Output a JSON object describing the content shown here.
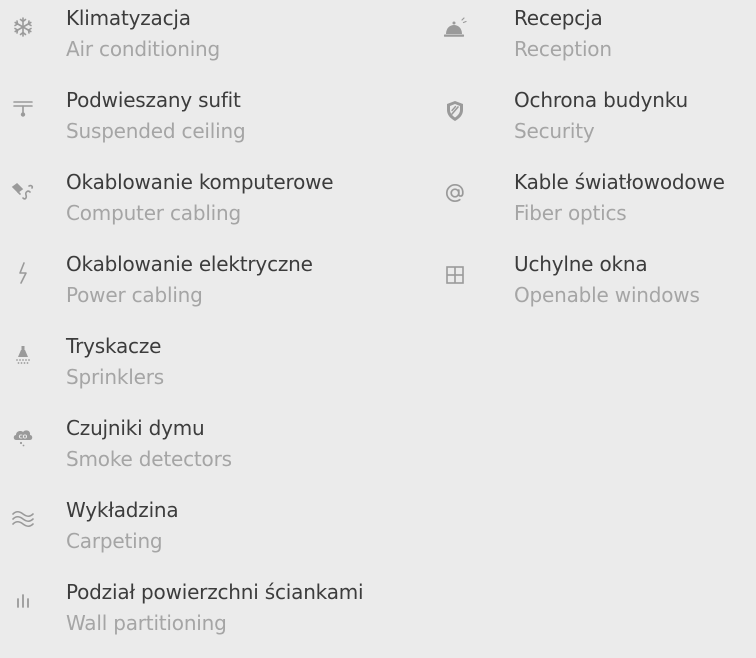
{
  "amenities": {
    "left": [
      {
        "icon": "snowflake-icon",
        "name": "Klimatyzacja",
        "sub": "Air conditioning"
      },
      {
        "icon": "ceiling-lamp-icon",
        "name": "Podwieszany sufit",
        "sub": "Suspended ceiling"
      },
      {
        "icon": "network-cable-icon",
        "name": "Okablowanie komputerowe",
        "sub": "Computer cabling"
      },
      {
        "icon": "lightning-icon",
        "name": "Okablowanie elektryczne",
        "sub": "Power cabling"
      },
      {
        "icon": "sprinkler-icon",
        "name": "Tryskacze",
        "sub": "Sprinklers"
      },
      {
        "icon": "smoke-cloud-icon",
        "name": "Czujniki dymu",
        "sub": "Smoke detectors"
      },
      {
        "icon": "wavy-lines-icon",
        "name": "Wykładzina",
        "sub": "Carpeting"
      },
      {
        "icon": "partition-bars-icon",
        "name": "Podział powierzchni ściankami",
        "sub": "Wall partitioning"
      }
    ],
    "right": [
      {
        "icon": "service-bell-icon",
        "name": "Recepcja",
        "sub": "Reception"
      },
      {
        "icon": "shield-icon",
        "name": "Ochrona budynku",
        "sub": "Security"
      },
      {
        "icon": "at-sign-icon",
        "name": "Kable światłowodowe",
        "sub": "Fiber optics"
      },
      {
        "icon": "window-icon",
        "name": "Uchylne okna",
        "sub": "Openable windows"
      }
    ]
  },
  "colors": {
    "background": "#ebebeb",
    "name_text": "#3c3c3c",
    "sub_text": "#a5a5a5",
    "icon": "#9a9a9a"
  }
}
